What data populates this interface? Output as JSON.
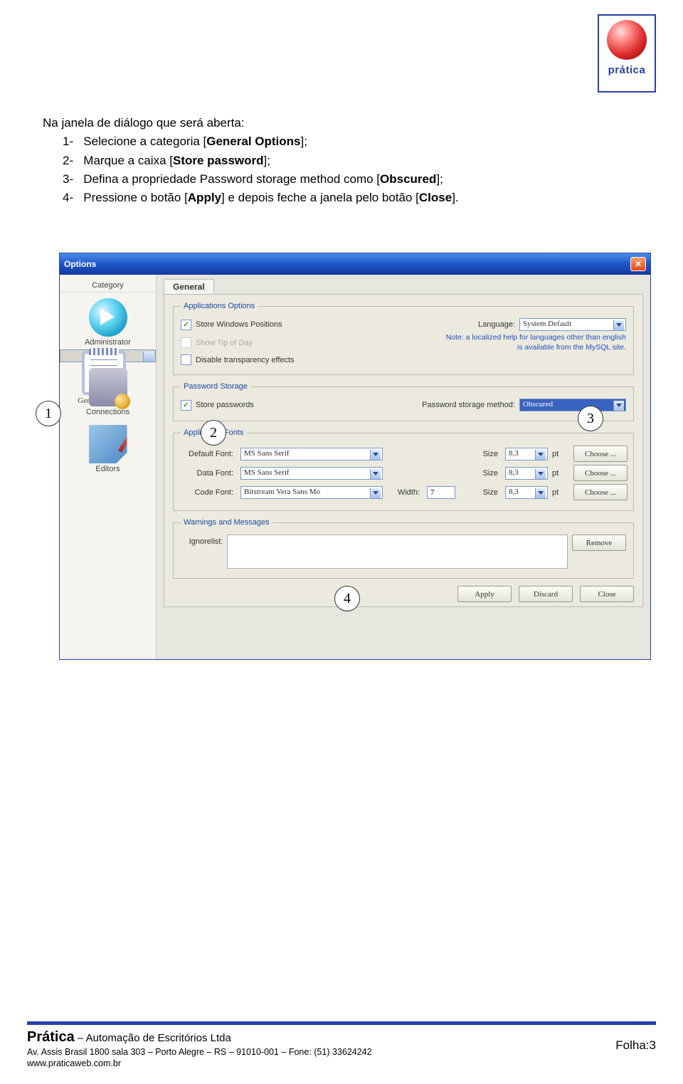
{
  "logo": {
    "brand": "prática"
  },
  "instructions": {
    "opening": "Na janela de diálogo que será aberta:",
    "items": [
      {
        "n": "1-",
        "pre": "Selecione a categoria [",
        "bold": "General Options",
        "post": "];"
      },
      {
        "n": "2-",
        "pre": "Marque a caixa [",
        "bold": "Store password",
        "post": "];"
      },
      {
        "n": "3-",
        "pre": "Defina a propriedade Password storage method como [",
        "bold": "Obscured",
        "post": "];"
      },
      {
        "n": "4-",
        "pre": "Pressione o botão [",
        "bold": "Apply",
        "post": "] e depois feche a janela pelo botão [",
        "bold2": "Close",
        "post2": "]."
      }
    ]
  },
  "callouts": {
    "c1": "1",
    "c2": "2",
    "c3": "3",
    "c4": "4"
  },
  "dialog": {
    "title": "Options",
    "sidebar_header": "Category",
    "categories": [
      "Administrator",
      "General Options",
      "Connections",
      "Editors"
    ],
    "tab": "General",
    "app_options": {
      "legend": "Applications Options",
      "store_win": "Store Windows Positions",
      "show_tip": "Show Tip of Day",
      "disable_trans": "Disable transparency effects",
      "language_label": "Language:",
      "language_value": "System Default",
      "note": "Note: a localized help for languages other than english is available from the MySQL site."
    },
    "pw": {
      "legend": "Password Storage",
      "store_pw": "Store passwords",
      "method_label": "Password storage method:",
      "method_value": "Obscured"
    },
    "fonts": {
      "legend": "Application Fonts",
      "rows": [
        {
          "label": "Default Font:",
          "font": "MS Sans Serif",
          "width_label": "",
          "width": "",
          "size_label": "Size",
          "size": "8,3",
          "pt": "pt",
          "choose": "Choose ..."
        },
        {
          "label": "Data Font:",
          "font": "MS Sans Serif",
          "width_label": "",
          "width": "",
          "size_label": "Size",
          "size": "8,3",
          "pt": "pt",
          "choose": "Choose ..."
        },
        {
          "label": "Code Font:",
          "font": "Bitstream Vera Sans Mo",
          "width_label": "Width:",
          "width": "7",
          "size_label": "Size",
          "size": "8,3",
          "pt": "pt",
          "choose": "Choose ..."
        }
      ]
    },
    "warn": {
      "legend": "Warnings and Messages",
      "ignore_label": "Ignorelist:",
      "remove": "Remove"
    },
    "buttons": {
      "apply": "Apply",
      "discard": "Discard",
      "close": "Close"
    }
  },
  "footer": {
    "company_bold": "Prática",
    "company_rest": " – Automação de Escritórios Ltda",
    "address": "Av. Assis Brasil 1800 sala 303 – Porto Alegre – RS – 91010-001 – Fone: (51) 33624242",
    "url": "www.praticaweb.com.br",
    "page": "Folha:3"
  }
}
